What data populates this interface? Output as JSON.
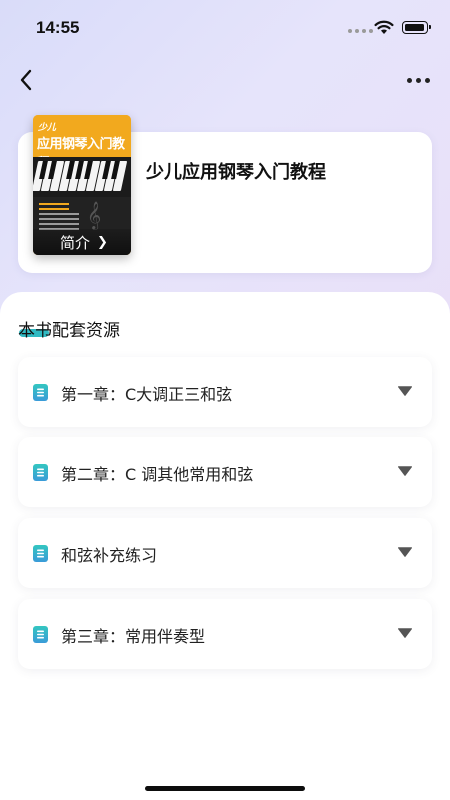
{
  "status_bar": {
    "time": "14:55"
  },
  "book": {
    "cover_series": "少儿",
    "cover_title": "应用钢琴入门教程",
    "cover_intro": "简介",
    "title": "少儿应用钢琴入门教程"
  },
  "section": {
    "title": "本书配套资源"
  },
  "chapters": [
    {
      "label": "第一章：C大调正三和弦"
    },
    {
      "label": "第二章：C 调其他常用和弦"
    },
    {
      "label": "和弦补充练习"
    },
    {
      "label": "第三章：常用伴奏型"
    }
  ],
  "colors": {
    "accent": "#2fb9c2",
    "icon_gradient_top": "#33c6c0",
    "icon_gradient_bottom": "#3a9bd8"
  },
  "icons": {
    "back": "chevron-left-icon",
    "more": "more-dots-icon",
    "chapter_doc": "document-icon",
    "expand": "triangle-down-icon"
  }
}
